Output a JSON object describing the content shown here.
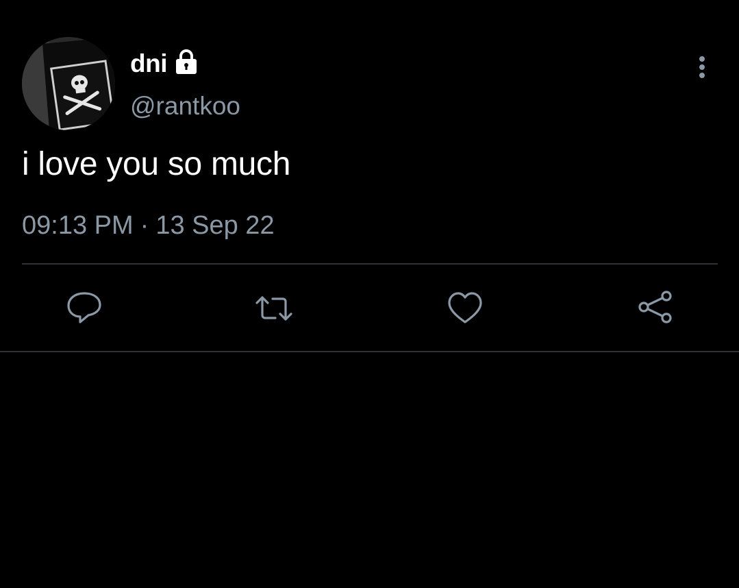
{
  "tweet": {
    "display_name": "dni",
    "handle": "@rantkoo",
    "text": "i love you so much",
    "time": "09:13 PM",
    "separator": "·",
    "date": "13 Sep 22",
    "protected_icon": "lock-icon",
    "avatar_icon": "skull-crossbones-patch"
  },
  "actions": [
    {
      "name": "reply",
      "icon": "reply-icon"
    },
    {
      "name": "retweet",
      "icon": "retweet-icon"
    },
    {
      "name": "like",
      "icon": "heart-icon"
    },
    {
      "name": "share",
      "icon": "share-icon"
    }
  ],
  "colors": {
    "background": "#000000",
    "primary_text": "#ffffff",
    "secondary_text": "#8b98a5",
    "divider": "#2f3336"
  }
}
